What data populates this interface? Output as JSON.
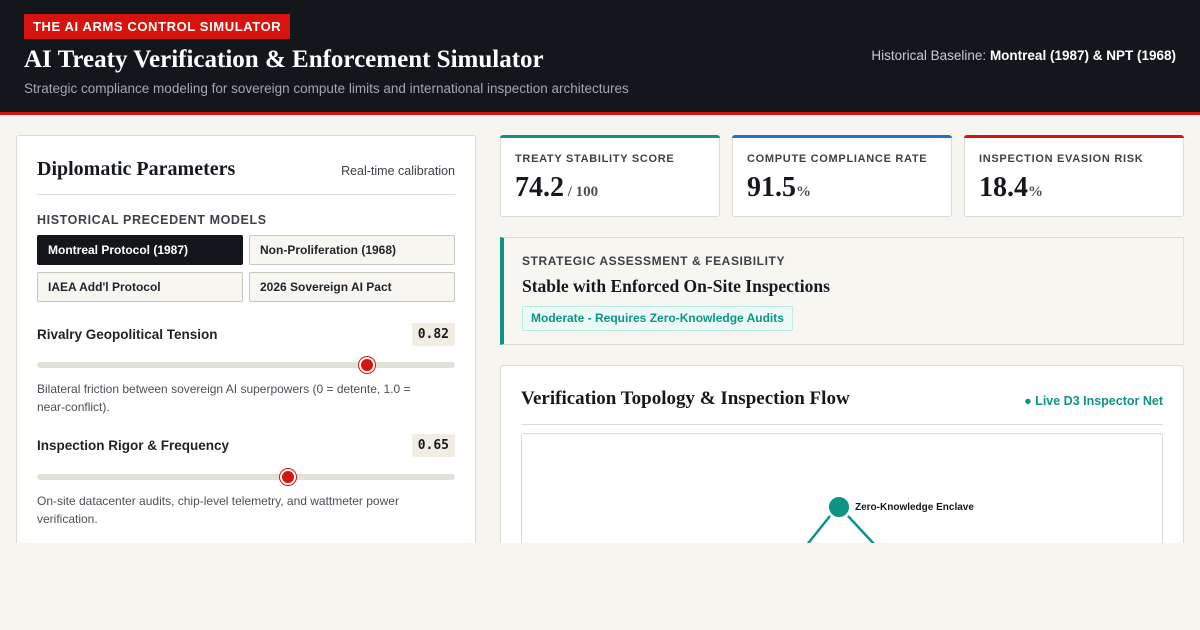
{
  "header": {
    "tag": "THE AI ARMS CONTROL SIMULATOR",
    "title": "AI Treaty Verification & Enforcement Simulator",
    "subtitle": "Strategic compliance modeling for sovereign compute limits and international inspection architectures",
    "baseline_label": "Historical Baseline:",
    "baseline_value": "Montreal (1987) & NPT (1968)"
  },
  "params": {
    "title": "Diplomatic Parameters",
    "note": "Real-time calibration",
    "precedent_label": "HISTORICAL PRECEDENT MODELS",
    "presets": [
      {
        "label": "Montreal Protocol (1987)",
        "active": true
      },
      {
        "label": "Non-Proliferation (1968)",
        "active": false
      },
      {
        "label": "IAEA Add'l Protocol",
        "active": false
      },
      {
        "label": "2026 Sovereign AI Pact",
        "active": false
      }
    ],
    "sliders": [
      {
        "label": "Rivalry Geopolitical Tension",
        "value": "0.82",
        "level": 0.79,
        "desc": "Bilateral friction between sovereign AI superpowers (0 = detente, 1.0 = near-conflict)."
      },
      {
        "label": "Inspection Rigor & Frequency",
        "value": "0.65",
        "level": 0.6,
        "desc": "On-site datacenter audits, chip-level telemetry, and wattmeter power verification."
      }
    ]
  },
  "metrics": [
    {
      "label": "TREATY STABILITY SCORE",
      "value": "74.2",
      "unit": " / 100",
      "color": "#0e9384"
    },
    {
      "label": "COMPUTE COMPLIANCE RATE",
      "value": "91.5",
      "unit": "%",
      "color": "#1f6fd6"
    },
    {
      "label": "INSPECTION EVASION RISK",
      "value": "18.4",
      "unit": "%",
      "color": "#d6140d"
    }
  ],
  "assessment": {
    "label": "STRATEGIC ASSESSMENT & FEASIBILITY",
    "title": "Stable with Enforced On-Site Inspections",
    "badge": "Moderate - Requires Zero-Knowledge Audits"
  },
  "topology": {
    "title": "Verification Topology & Inspection Flow",
    "live": "● Live D3 Inspector Net",
    "node_label": "Zero-Knowledge Enclave"
  },
  "colors": {
    "accent_red": "#d6140d",
    "teal": "#0e9384",
    "blue": "#1f6fd6",
    "dark": "#13171c"
  }
}
